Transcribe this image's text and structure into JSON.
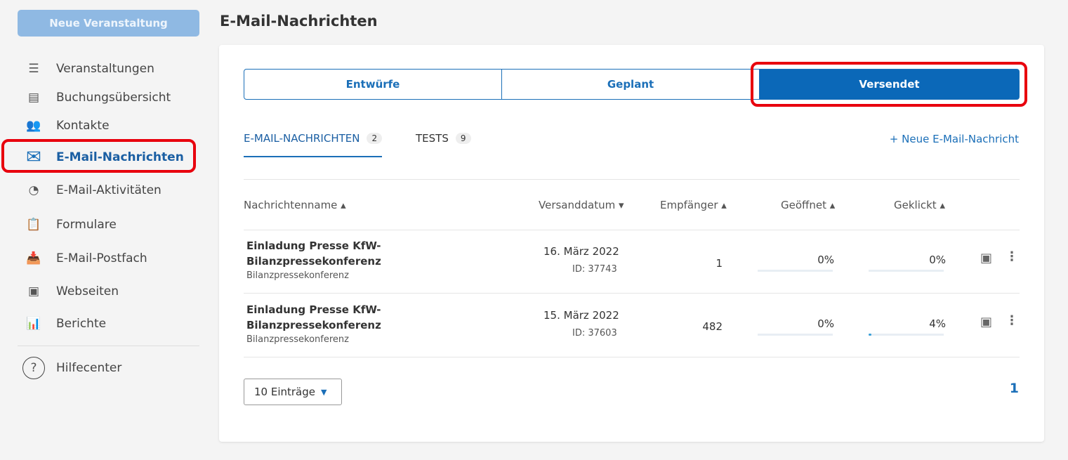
{
  "sidebar": {
    "new_event": "Neue Veranstaltung",
    "items": [
      {
        "label": "Veranstaltungen",
        "icon": "checklist-icon"
      },
      {
        "label": "Buchungsübersicht",
        "icon": "receipt-icon"
      },
      {
        "label": "Kontakte",
        "icon": "contacts-icon"
      },
      {
        "label": "E-Mail-Nachrichten",
        "icon": "envelope-icon"
      },
      {
        "label": "E-Mail-Aktivitäten",
        "icon": "activity-lock-icon"
      },
      {
        "label": "Formulare",
        "icon": "clipboard-icon"
      },
      {
        "label": "E-Mail-Postfach",
        "icon": "inbox-icon"
      },
      {
        "label": "Webseiten",
        "icon": "webpage-lock-icon"
      },
      {
        "label": "Berichte",
        "icon": "bar-chart-icon"
      }
    ],
    "help": "Hilfecenter"
  },
  "page_title": "E-Mail-Nachrichten",
  "segments": [
    "Entwürfe",
    "Geplant",
    "Versendet"
  ],
  "tabs": [
    {
      "label": "E-MAIL-NACHRICHTEN",
      "count": "2"
    },
    {
      "label": "TESTS",
      "count": "9"
    }
  ],
  "new_mail": "+ Neue E-Mail-Nachricht",
  "columns": [
    "Nachrichtenname ▴",
    "Versanddatum ▾",
    "Empfänger ▴",
    "Geöffnet ▴",
    "Geklickt ▴"
  ],
  "rows": [
    {
      "name1": "Einladung Presse KfW-",
      "name2": "Bilanzpressekonferenz",
      "sub": "Bilanzpressekonferenz",
      "date": "16. März 2022",
      "id": "ID: 37743",
      "recipients": "1",
      "opened": "0%",
      "clicked": "0%",
      "opened_pct": 0,
      "clicked_pct": 0
    },
    {
      "name1": "Einladung Presse KfW-",
      "name2": "Bilanzpressekonferenz",
      "sub": "Bilanzpressekonferenz",
      "date": "15. März 2022",
      "id": "ID: 37603",
      "recipients": "482",
      "opened": "0%",
      "clicked": "4%",
      "opened_pct": 0,
      "clicked_pct": 4
    }
  ],
  "page_size": "10 Einträge",
  "page": "1"
}
